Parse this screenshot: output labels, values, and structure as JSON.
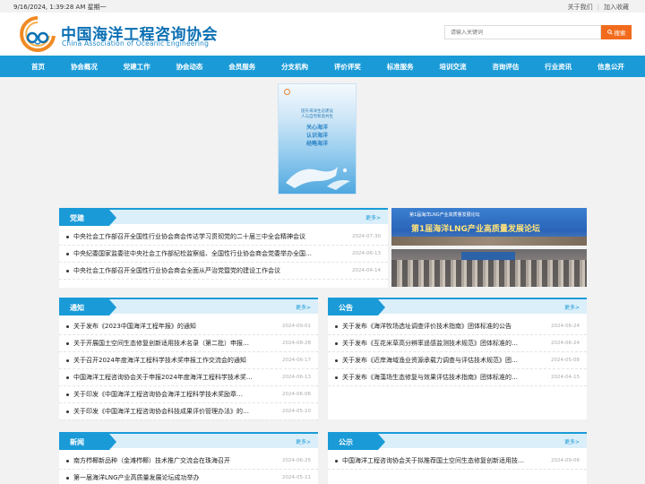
{
  "topbar": {
    "datetime": "9/16/2024, 1:39:28 AM 星期一",
    "about": "关于我们",
    "favorite": "加入收藏"
  },
  "header": {
    "brand_cn": "中国海洋工程咨询协会",
    "brand_en": "China Association of Oceanic Engineering",
    "search_placeholder": "请输入关键词",
    "search_button": "搜索"
  },
  "nav": [
    "首页",
    "协会概况",
    "党建工作",
    "协会动态",
    "会员服务",
    "分支机构",
    "评价评奖",
    "标准服务",
    "培训交流",
    "咨询评估",
    "行业资讯",
    "信息公开"
  ],
  "banner": {
    "lines": [
      "提升海洋生态建设",
      "人与自然和谐共生"
    ],
    "slogan": [
      "关心海洋",
      "认识海洋",
      "经略海洋"
    ]
  },
  "photo": {
    "title": "第1届海洋LNG产业高质量发展论坛",
    "big": "第1届海洋LNG产业高质量发展论坛"
  },
  "more_label": "更多>",
  "sections": {
    "party": {
      "title": "党建",
      "items": [
        {
          "title": "中央社会工作部召开全国性行业协会商会传达学习贯彻党的二十届三中全会精神会议",
          "date": "2024-07-30"
        },
        {
          "title": "中央纪委国家监委驻中央社会工作部纪检监察组、全国性行业协会商会党委举办全国…",
          "date": "2024-06-13"
        },
        {
          "title": "中央社会工作部召开全国性行业协会商会全面从严治党暨党的建设工作会议",
          "date": "2024-04-14"
        }
      ]
    },
    "notice": {
      "title": "通知",
      "items": [
        {
          "title": "关于发布《2023中国海洋工程年报》的通知",
          "date": "2024-09-01"
        },
        {
          "title": "关于开展国土空间生态修复创新适用技术名录（第二批）申报…",
          "date": "2024-08-28"
        },
        {
          "title": "关于召开2024年度海洋工程科学技术奖申报工作交流会的通知",
          "date": "2024-06-17"
        },
        {
          "title": "中国海洋工程咨询协会关于申报2024年度海洋工程科学技术奖…",
          "date": "2024-06-13"
        },
        {
          "title": "关于印发《中国海洋工程咨询协会海洋工程科学技术奖励章…",
          "date": "2024-06-06"
        },
        {
          "title": "关于印发《中国海洋工程咨询协会科技成果评价管理办法》的…",
          "date": "2024-05-10"
        }
      ]
    },
    "bulletin": {
      "title": "公告",
      "items": [
        {
          "title": "关于发布《海洋牧场选址调查评价技术指南》团体标准的公告",
          "date": "2024-06-24"
        },
        {
          "title": "关于发布《互花米草高分辨率遥感监测技术规范》团体标准的…",
          "date": "2024-06-24"
        },
        {
          "title": "关于发布《近岸海域渔业资源承载力调查与评估技术规范》团…",
          "date": "2024-05-08"
        },
        {
          "title": "关于发布《海藻场生态修复与效果评估技术指南》团体标准的…",
          "date": "2024-04-15"
        }
      ]
    },
    "news": {
      "title": "新闻",
      "items": [
        {
          "title": "南方栉椰新品种（金滩栉椰）技术推广交流会在珠海召开",
          "date": "2024-06-25"
        },
        {
          "title": "第一届海洋LNG产业高质量发展论坛成功举办",
          "date": "2024-05-11"
        }
      ]
    },
    "announce": {
      "title": "公示",
      "items": [
        {
          "title": "中国海洋工程咨询协会关于拟推荐国土空间生态修复创新适用技…",
          "date": "2024-09-06"
        }
      ]
    }
  },
  "colors": {
    "primary": "#1a9bd8",
    "accent": "#f26b1d",
    "brand": "#0a6fb3"
  }
}
